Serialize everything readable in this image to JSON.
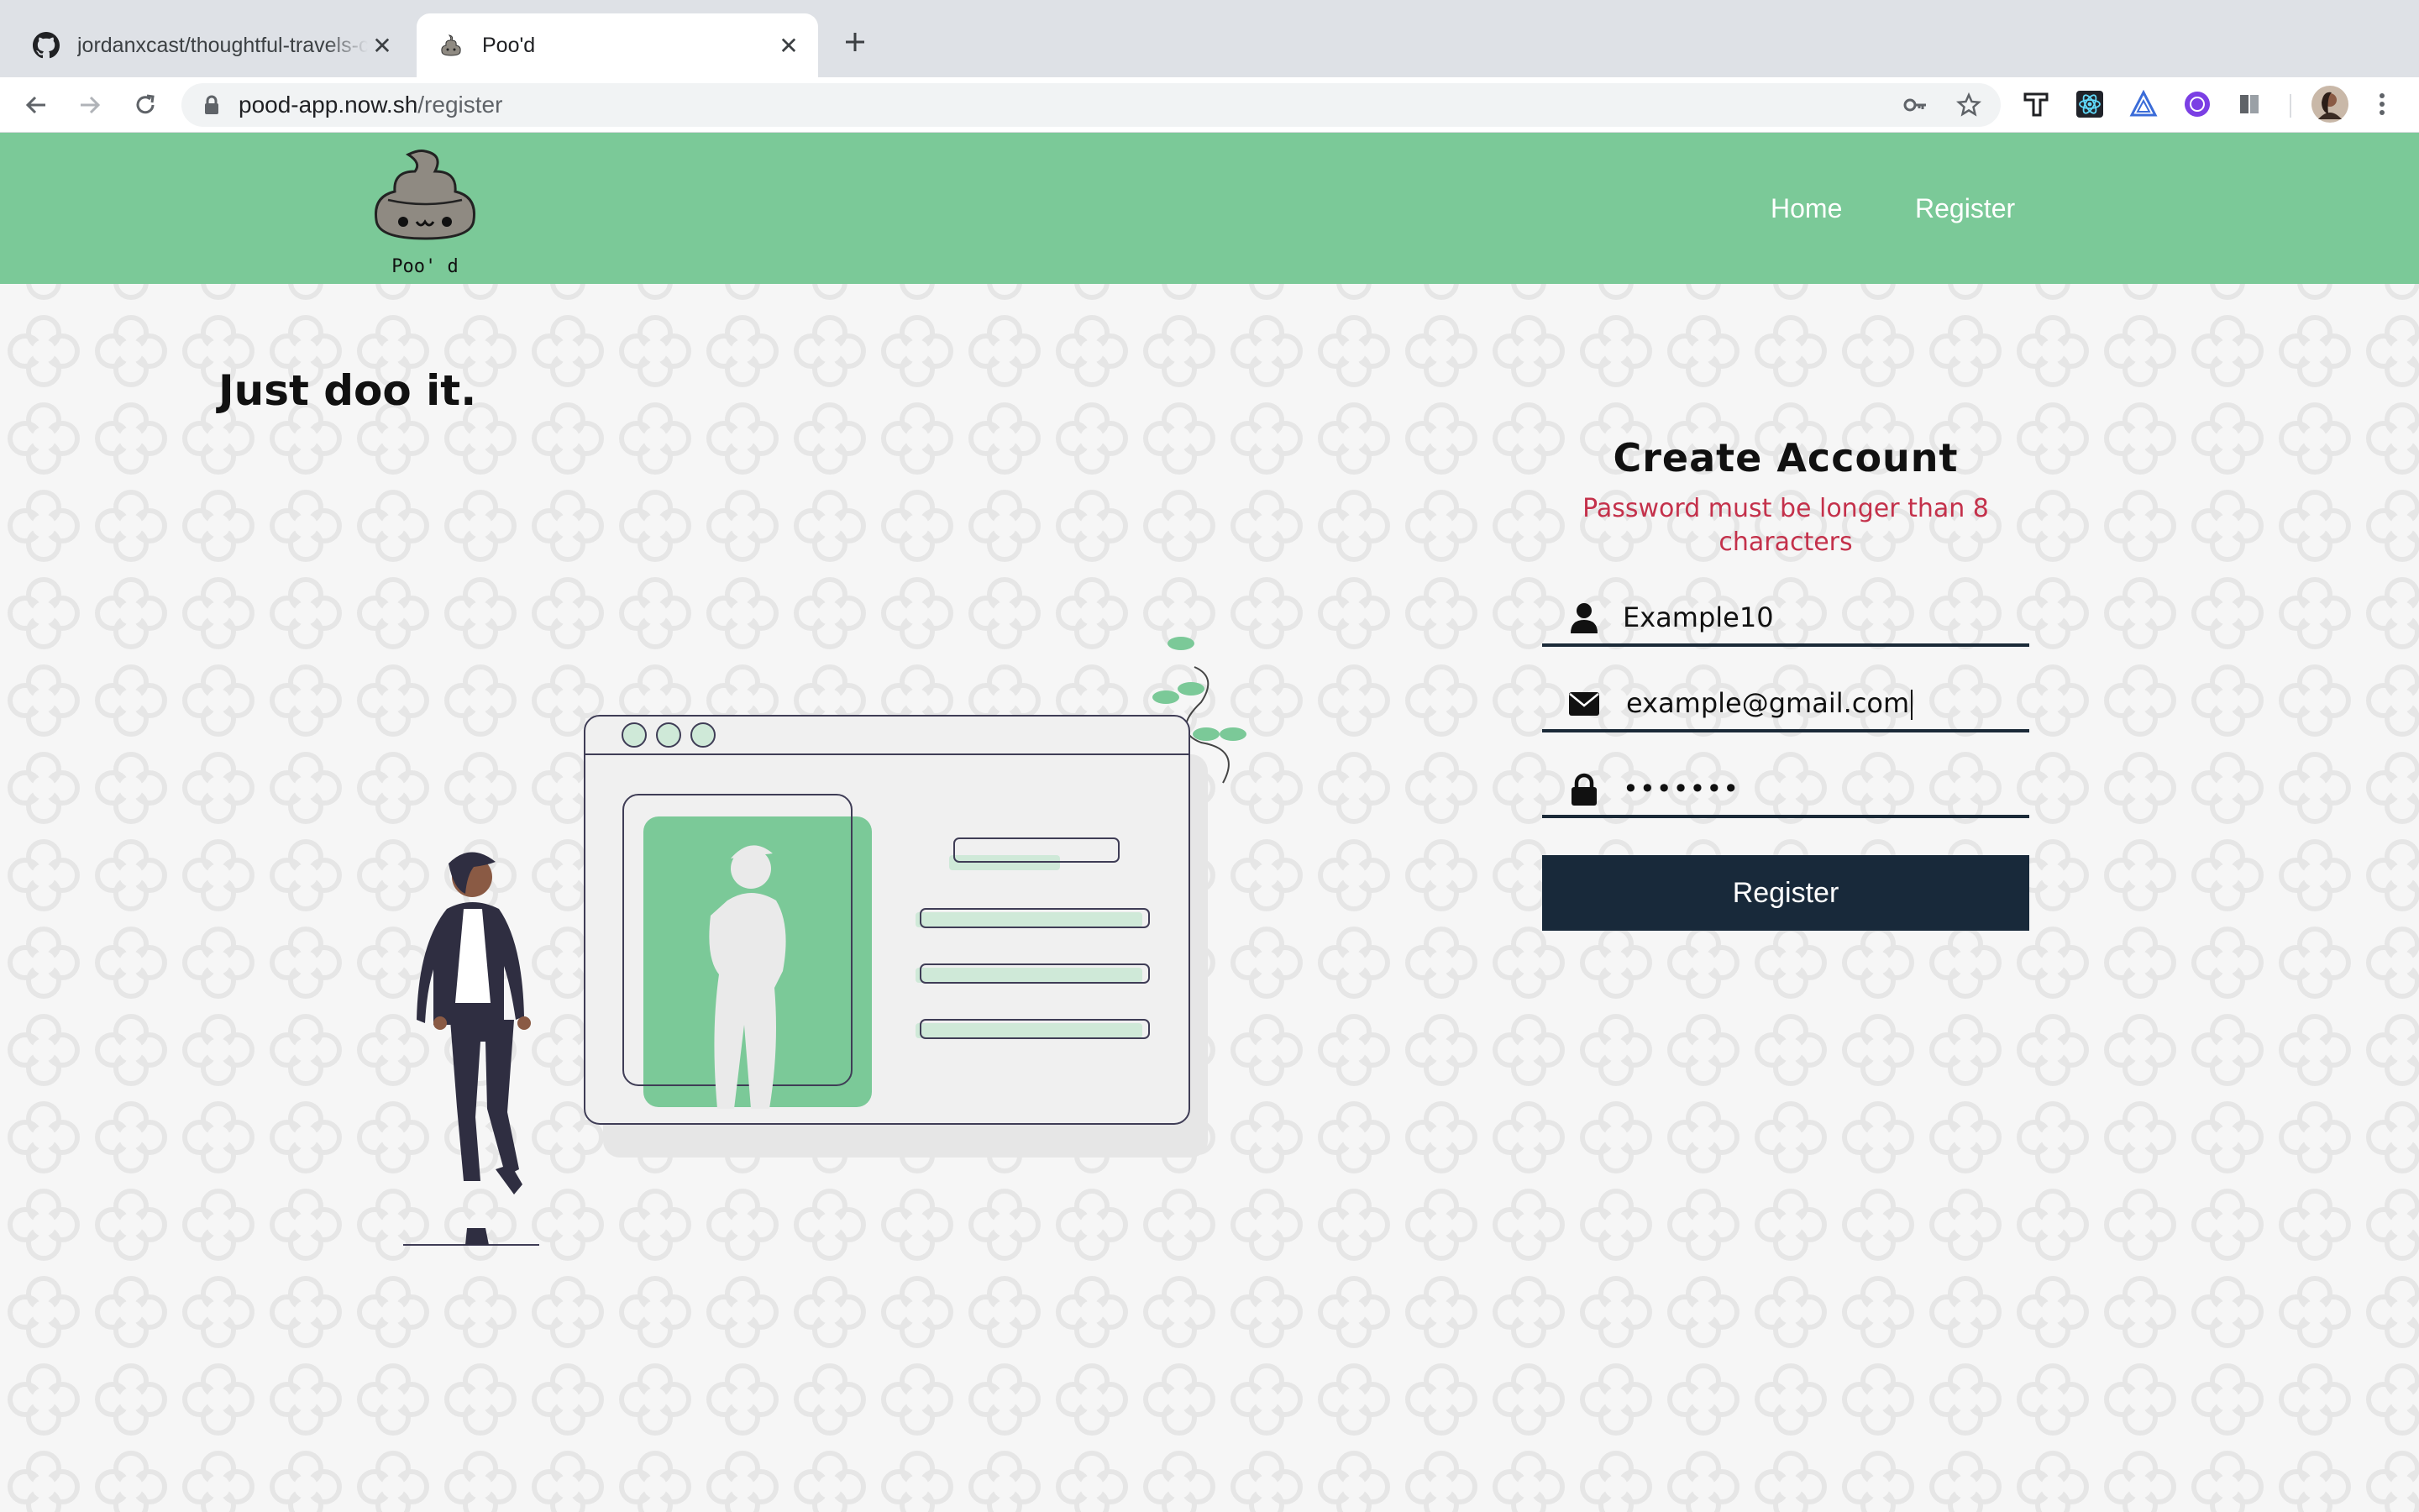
{
  "browser": {
    "tabs": [
      {
        "title": "jordanxcast/thoughtful-travels-c",
        "icon": "github-icon",
        "active": false
      },
      {
        "title": "Poo'd",
        "icon": "poo-icon",
        "active": true
      }
    ],
    "url_host": "pood-app.now.sh",
    "url_path": "/register"
  },
  "header": {
    "logo_text": "Poo' d",
    "nav": {
      "home": "Home",
      "register": "Register"
    },
    "color": "#7bc998"
  },
  "hero": {
    "tagline": "Just doo it."
  },
  "form": {
    "title": "Create Account",
    "error": "Password must be longer than 8 characters",
    "username": "Example10",
    "email": "example@gmail.com",
    "password_mask": "•••••••",
    "submit_label": "Register",
    "error_color": "#c4314b",
    "button_color": "#18293a"
  }
}
